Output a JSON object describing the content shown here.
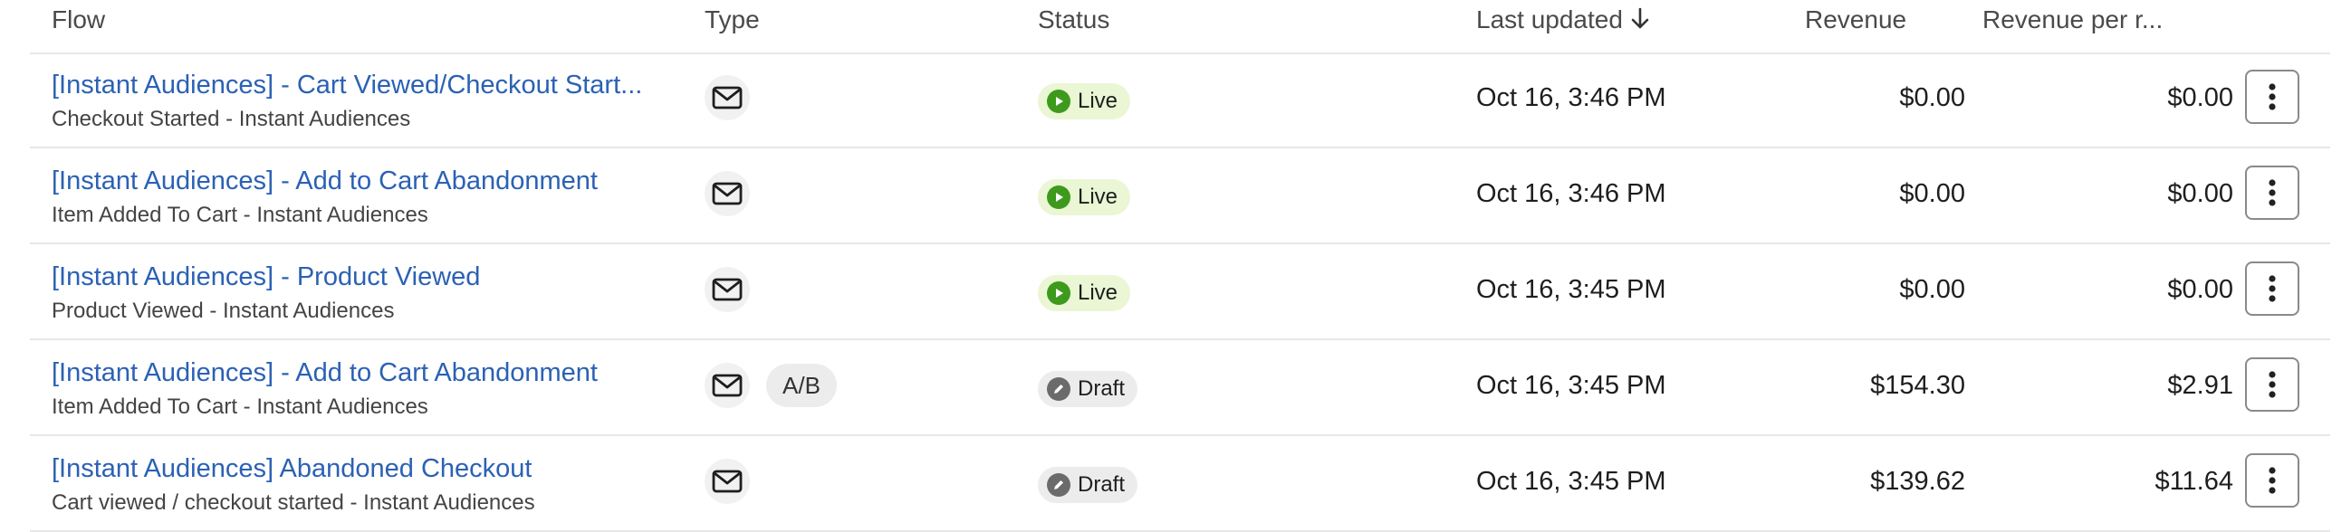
{
  "columns": {
    "flow": "Flow",
    "type": "Type",
    "status": "Status",
    "last_updated": "Last updated",
    "revenue": "Revenue",
    "revenue_per_recipient": "Revenue per r..."
  },
  "sort": {
    "column": "last_updated",
    "direction": "descending",
    "icon": "arrow-down-icon"
  },
  "rows": [
    {
      "name": "[Instant Audiences] - Cart Viewed/Checkout Start...",
      "trigger": "Checkout Started - Instant Audiences",
      "type_icon": "mail-icon",
      "ab": "",
      "status": "Live",
      "status_kind": "live",
      "last_updated": "Oct 16, 3:46 PM",
      "revenue": "$0.00",
      "revenue_per_recipient": "$0.00"
    },
    {
      "name": "[Instant Audiences] - Add to Cart Abandonment",
      "trigger": "Item Added To Cart - Instant Audiences",
      "type_icon": "mail-icon",
      "ab": "",
      "status": "Live",
      "status_kind": "live",
      "last_updated": "Oct 16, 3:46 PM",
      "revenue": "$0.00",
      "revenue_per_recipient": "$0.00"
    },
    {
      "name": "[Instant Audiences] - Product Viewed",
      "trigger": "Product Viewed - Instant Audiences",
      "type_icon": "mail-icon",
      "ab": "",
      "status": "Live",
      "status_kind": "live",
      "last_updated": "Oct 16, 3:45 PM",
      "revenue": "$0.00",
      "revenue_per_recipient": "$0.00"
    },
    {
      "name": "[Instant Audiences] - Add to Cart Abandonment",
      "trigger": "Item Added To Cart - Instant Audiences",
      "type_icon": "mail-icon",
      "ab": "A/B",
      "status": "Draft",
      "status_kind": "draft",
      "last_updated": "Oct 16, 3:45 PM",
      "revenue": "$154.30",
      "revenue_per_recipient": "$2.91"
    },
    {
      "name": "[Instant Audiences] Abandoned Checkout",
      "trigger": "Cart viewed / checkout started - Instant Audiences",
      "type_icon": "mail-icon",
      "ab": "",
      "status": "Draft",
      "status_kind": "draft",
      "last_updated": "Oct 16, 3:45 PM",
      "revenue": "$139.62",
      "revenue_per_recipient": "$11.64"
    }
  ],
  "colors": {
    "link": "#2b61b4",
    "live_bg": "#eaf6d4",
    "live_icon": "#3d9a1c",
    "draft_bg": "#ececec",
    "draft_icon": "#6b6b6b"
  }
}
